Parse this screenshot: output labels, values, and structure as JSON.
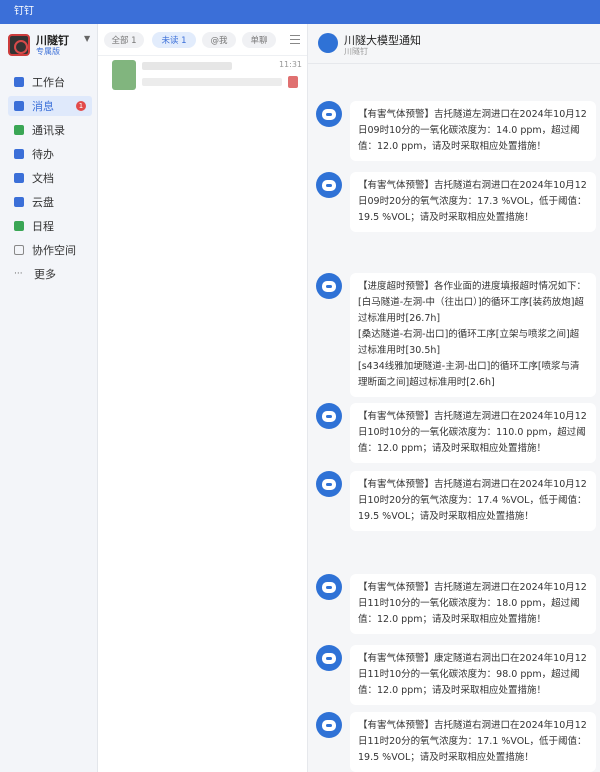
{
  "window": {
    "title": "钉钉"
  },
  "profile": {
    "name": "川隧钉",
    "tag": "专属版"
  },
  "sidebar": {
    "items": [
      {
        "label": "工作台",
        "icon": "workbench-icon",
        "color": "#3b6fd8"
      },
      {
        "label": "消息",
        "icon": "message-icon",
        "color": "#3b6fd8",
        "badge": "1"
      },
      {
        "label": "通讯录",
        "icon": "contacts-icon",
        "color": "#3aa655"
      },
      {
        "label": "待办",
        "icon": "todo-icon",
        "color": "#3b6fd8"
      },
      {
        "label": "文档",
        "icon": "doc-icon",
        "color": "#3b6fd8"
      },
      {
        "label": "云盘",
        "icon": "cloud-icon",
        "color": "#3b6fd8"
      },
      {
        "label": "日程",
        "icon": "calendar-icon",
        "color": "#3aa655"
      },
      {
        "label": "协作空间",
        "icon": "space-icon",
        "color": "#888888"
      },
      {
        "label": "更多",
        "icon": "more-icon",
        "color": "#888888"
      }
    ]
  },
  "tabs": [
    {
      "label": "全部 1"
    },
    {
      "label": "未读 1"
    },
    {
      "label": "@我"
    },
    {
      "label": "单聊"
    }
  ],
  "conversation": {
    "time": "11:31"
  },
  "chat": {
    "title": "川隧大模型通知",
    "subtitle": "川隧钉",
    "messages": [
      {
        "text": "【有害气体预警】吉托隧道左洞进口在2024年10月12日09时10分的一氧化碳浓度为：14.0 ppm，超过阈值：12.0 ppm，请及时采取相应处置措施！"
      },
      {
        "text": "【有害气体预警】吉托隧道右洞进口在2024年10月12日09时20分的氧气浓度为：17.3 %VOL，低于阈值：19.5 %VOL；请及时采取相应处置措施！"
      },
      {
        "text": "【进度超时预警】各作业面的进度填报超时情况如下：\n[白马隧道-左洞-中（往出口）]的循环工序[装药放炮]超过标准用时[26.7h]\n[桑达隧道-右洞-出口]的循环工序[立架与喷浆之间]超过标准用时[30.5h]\n[s434线雅加埂隧道-主洞-出口]的循环工序[喷浆与清理断面之间]超过标准用时[2.6h]"
      },
      {
        "text": "【有害气体预警】吉托隧道左洞进口在2024年10月12日10时10分的一氧化碳浓度为：110.0 ppm，超过阈值：12.0 ppm；请及时采取相应处置措施！"
      },
      {
        "text": "【有害气体预警】吉托隧道右洞进口在2024年10月12日10时20分的氧气浓度为：17.4 %VOL，低于阈值：19.5 %VOL；请及时采取相应处置措施！"
      },
      {
        "text": "【有害气体预警】吉托隧道左洞进口在2024年10月12日11时10分的一氧化碳浓度为：18.0 ppm，超过阈值：12.0 ppm；请及时采取相应处置措施！"
      },
      {
        "text": "【有害气体预警】康定隧道右洞出口在2024年10月12日11时10分的一氧化碳浓度为：98.0 ppm，超过阈值：12.0 ppm；请及时采取相应处置措施！"
      },
      {
        "text": "【有害气体预警】吉托隧道右洞进口在2024年10月12日11时20分的氧气浓度为：17.1 %VOL，低于阈值：19.5 %VOL；请及时采取相应处置措施！"
      }
    ]
  }
}
